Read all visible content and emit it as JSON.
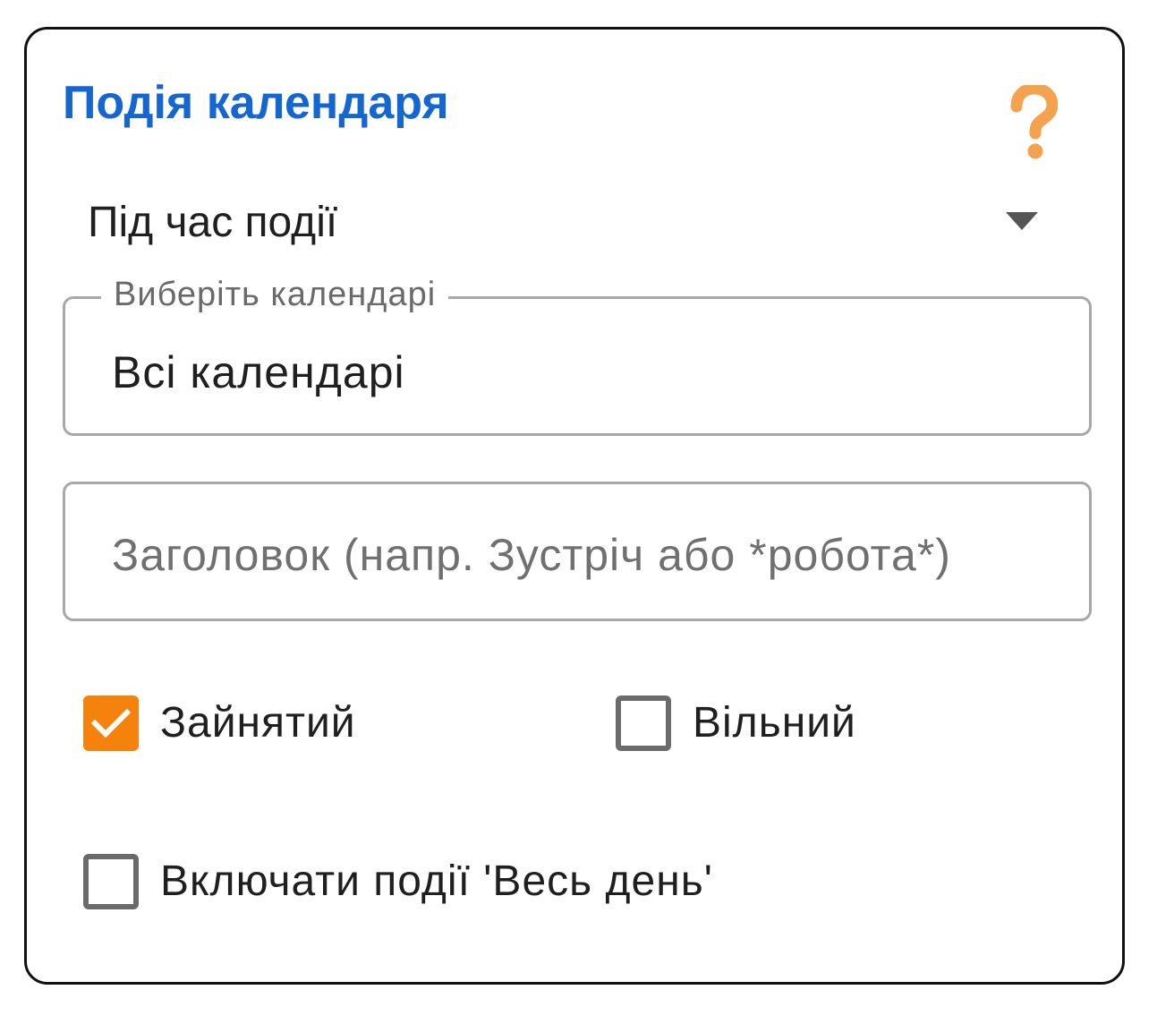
{
  "header": {
    "title": "Подія календаря",
    "help_icon": "question-mark-icon",
    "help_icon_color": "#f5a24f"
  },
  "event_time": {
    "selected": "Під час події",
    "caret_icon": "triangle-down-icon"
  },
  "calendars": {
    "label": "Виберіть календарі",
    "value": "Всі календарі"
  },
  "title_filter": {
    "value": "",
    "placeholder": "Заголовок (напр. Зустріч або *робота*)"
  },
  "options": {
    "busy": {
      "label": "Зайнятий",
      "checked": true
    },
    "free": {
      "label": "Вільний",
      "checked": false
    },
    "all_day": {
      "label": "Включати події 'Весь день'",
      "checked": false
    }
  },
  "colors": {
    "title": "#1466d1",
    "checkbox_checked": "#f5820d",
    "checkbox_border": "#6b6b6b",
    "field_border": "#a8a8a8"
  }
}
